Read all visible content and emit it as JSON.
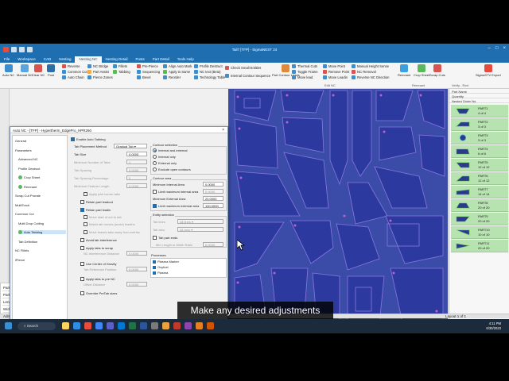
{
  "window": {
    "title": "Tail7 [TFP] - SigmaNEST 24"
  },
  "menu_tabs": [
    "File",
    "Workspace",
    "CAD",
    "Nesting",
    "Nesting NC",
    "Nesting Detail",
    "Posts",
    "Part Detail",
    "Tools Help"
  ],
  "active_menu_tab": 4,
  "ribbon": {
    "big_buttons": [
      "Auto NC",
      "Manual NC",
      "Clear NC",
      "Post"
    ],
    "group1": [
      "Reverse",
      "Common Cut",
      "Auto Chain"
    ],
    "group2": [
      "NC Bridge",
      "Part Assist",
      "Pierce Zones"
    ],
    "group3": [
      "Fillets",
      "Tabbing"
    ],
    "group4": [
      "Pre-Pierce",
      "Sequencing",
      "Bevel"
    ],
    "group5": [
      "Align Auto Mark",
      "Apply to Same",
      "Reorder"
    ],
    "group6": [
      "Profile Destruct",
      "NC text (Beta)",
      "Technology Table"
    ],
    "check_buttons": [
      "Check Small Entities",
      "Internal Contour Sequence"
    ],
    "group7_big": [
      "Part Contour Leads"
    ],
    "group8": [
      "Thermal Cuts",
      "Toggle Frame",
      "Move lead"
    ],
    "group9": [
      "Move Point",
      "Remove Point",
      "Move Leadin"
    ],
    "group10": [
      "Manual Height Sense",
      "NC Removal",
      "Reverse NC Direction"
    ],
    "remnant_group": [
      "Remnant",
      "Crop Sheet",
      "Scrap Cuts"
    ],
    "right_group": [
      "SigmaSTV Export"
    ],
    "group_labels": [
      "Edit NC",
      "Remnant",
      "Verify - Red"
    ]
  },
  "dialog": {
    "title": "Auto NC - [TFP] - Hypertherm_EdgePro_HPR260",
    "tree": [
      "General",
      "Parameters",
      "Advanced NC",
      "Profile Destruct",
      "Crop Sheet",
      "Remnant",
      "Scrap Cut Prorate",
      "MultiTorch",
      "Common Cut",
      "Multi Drop Cutting",
      "Auto Tabbing",
      "Tab Definition",
      "NC Fillets",
      "iPierce"
    ],
    "selected_tree_item": "Auto Tabbing",
    "enable_auto_tabbing": {
      "label": "Enable Auto Tabbing",
      "checked": true
    },
    "tab_placement_method": {
      "label": "Tab Placement Method",
      "value": "Gradual Tab"
    },
    "tab_size": {
      "label": "Tab Size",
      "value": "0.0000"
    },
    "min_tabs": {
      "label": "Minimum Number of Tabs",
      "value": "1"
    },
    "tab_spacing": {
      "label": "Tab Spacing",
      "value": "0.0000"
    },
    "tab_ratio": {
      "label": "Tab Spacing Percentage",
      "value": "0"
    },
    "feature_tab_length": {
      "label": "Minimum Feature Length",
      "value": "0.0000"
    },
    "left_checks": [
      {
        "label": "Apply part corner tabs",
        "checked": false,
        "disabled": true
      },
      {
        "label": "Retain part leadout",
        "checked": false,
        "disabled": false
      },
      {
        "label": "Retain part leadin",
        "checked": true,
        "disabled": false
      },
      {
        "label": "Move start of cut to tab",
        "checked": false,
        "disabled": true
      },
      {
        "label": "Match tab moves (avoid) leadins",
        "checked": false,
        "disabled": true
      },
      {
        "label": "Move leaves tabs away from entries",
        "checked": false,
        "disabled": true
      },
      {
        "label": "Avoid tab interference",
        "checked": false,
        "disabled": false
      },
      {
        "label": "Apply tabs to scrap",
        "checked": false,
        "disabled": false
      },
      {
        "label": "Use Center of Gravity",
        "checked": false,
        "disabled": false
      },
      {
        "label": "Apply tabs to pre NC",
        "checked": false,
        "disabled": false
      },
      {
        "label": "Override PreTab sizes",
        "checked": false,
        "disabled": false
      }
    ],
    "nc_interference_distance": {
      "label": "NC Interference Distance",
      "value": "0.0000"
    },
    "tab_reference_position": {
      "label": "Tab Reference Position",
      "value": "0.0000"
    },
    "offset_distance": {
      "label": "Offset Distance",
      "value": "0.0000"
    },
    "contour_selection": {
      "title": "Contour selection",
      "options": [
        "Internal and external",
        "Internal only",
        "External only",
        "Exclude open contours"
      ],
      "selected": 0
    },
    "contour_area": {
      "title": "Contour area",
      "min_internal": {
        "label": "Minimum Internal Area",
        "value": "0.0000"
      },
      "limit_max_internal": {
        "label": "Limit maximum internal area",
        "value": "0.0000"
      },
      "min_external": {
        "label": "Minimum External Area",
        "value": "20.0000"
      },
      "limit_max_external": {
        "label": "Limit maximum external area",
        "value": "100.0000",
        "checked": true
      }
    },
    "entity_selection": {
      "title": "Entity selection",
      "tab_lines": {
        "label": "Tab lines",
        "value": "All lines"
      },
      "tab_arcs": {
        "label": "Tab arcs",
        "value": "All arcs"
      },
      "tab_part_ends": {
        "label": "Tab part ends",
        "checked": false
      },
      "min_length": {
        "label": "Min Length to Width Ratio",
        "value": "0.0000"
      }
    },
    "processes": {
      "title": "Processes",
      "items": [
        "Plasma Marker",
        "Oxyfuel",
        "Plasma"
      ]
    },
    "pagination": "Layout 1 of 1",
    "buttons": {
      "set_default": "Set as Default",
      "preview": "Preview",
      "ok": "OK",
      "cancel": "Cancel"
    }
  },
  "parts": {
    "header": [
      "Part Name",
      "Quantity",
      "Nested Order No."
    ],
    "items": [
      {
        "name": "PART1",
        "qty": "4 of 4",
        "color": "#7ad06a"
      },
      {
        "name": "PART2",
        "qty": "3 of 3",
        "color": "#7ad06a"
      },
      {
        "name": "PART3",
        "qty": "3 of 3",
        "color": "#3aa0e0"
      },
      {
        "name": "PART4",
        "qty": "6 of 6",
        "color": "#7ad06a"
      },
      {
        "name": "PART5",
        "qty": "12 of 12",
        "color": "#7ad06a"
      },
      {
        "name": "PART6",
        "qty": "12 of 12",
        "color": "#7ad06a"
      },
      {
        "name": "PART7",
        "qty": "14 of 14",
        "color": "#7ad06a"
      },
      {
        "name": "PART8",
        "qty": "20 of 20",
        "color": "#7ad06a"
      },
      {
        "name": "PART9",
        "qty": "20 of 20",
        "color": "#7ad06a"
      },
      {
        "name": "PART10",
        "qty": "10 of 10",
        "color": "#7ad06a"
      },
      {
        "name": "PART11",
        "qty": "20 of 20",
        "color": "#7ad06a"
      }
    ]
  },
  "property_table": {
    "rows": [
      [
        "Parts Count",
        "78"
      ],
      [
        "Part Area",
        "79.2500"
      ],
      [
        "Length Used",
        "48.000"
      ],
      [
        "Width Used",
        "96.000"
      ]
    ]
  },
  "status_bar": {
    "left": "Admin BuildBuy",
    "middle": "Hypertherm_EdgePro_HPR260 Layout: Building | Layout: 1",
    "right": "Layout 1 of 1"
  },
  "caption": "Make any desired adjustments",
  "taskbar": {
    "search_placeholder": "Search",
    "time": "4:11 PM",
    "date": "6/30/2023"
  }
}
